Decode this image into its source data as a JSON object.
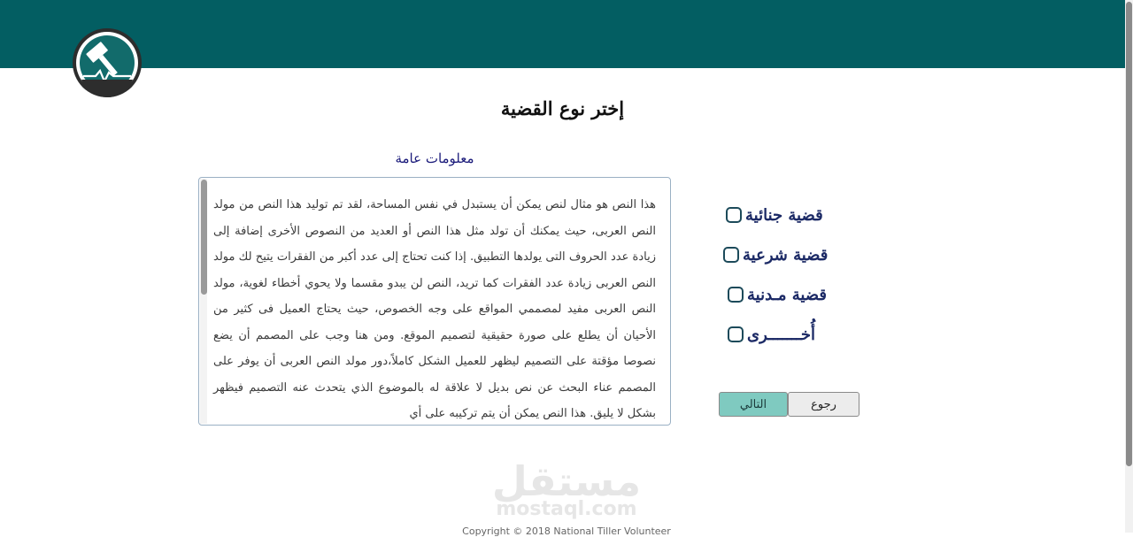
{
  "title": "إختر نوع القضية",
  "info": {
    "label": "معلومات عامة",
    "text": "هذا النص هو مثال لنص يمكن أن يستبدل في نفس المساحة، لقد تم توليد هذا النص من مولد النص العربى، حيث يمكنك أن تولد مثل هذا النص أو العديد من النصوص الأخرى إضافة إلى زيادة عدد الحروف التى يولدها التطبيق. إذا كنت تحتاج إلى عدد أكبر من الفقرات يتيح لك مولد النص العربى زيادة عدد الفقرات كما تريد، النص لن يبدو مقسما ولا يحوي أخطاء لغوية، مولد النص العربى مفيد لمصممي المواقع على وجه الخصوص، حيث يحتاج العميل فى كثير من الأحيان أن يطلع على صورة حقيقية لتصميم الموقع. ومن هنا وجب على المصمم أن يضع نصوصا مؤقتة على التصميم ليظهر للعميل الشكل كاملاً،دور مولد النص العربى أن يوفر على المصمم عناء البحث عن نص بديل لا علاقة له بالموضوع الذي يتحدث عنه التصميم فيظهر بشكل لا يليق. هذا النص يمكن أن يتم تركيبه على أي"
  },
  "options": [
    {
      "label": "قضية جنائية"
    },
    {
      "label": "قضية شرعية"
    },
    {
      "label": "قضية مـدنية"
    },
    {
      "label": "أُخـــــــرى"
    }
  ],
  "buttons": {
    "next": "التالي",
    "back": "رجوع"
  },
  "watermark": {
    "arabic": "مستقل",
    "latin": "mostaql.com"
  },
  "footer": "Copyright © 2018 National Tiller Volunteer",
  "colors": {
    "header": "#035e62",
    "accent": "#7fcac0",
    "option_text": "#1c2a66"
  },
  "icons": {
    "logo": "gavel-heartbeat-icon"
  }
}
